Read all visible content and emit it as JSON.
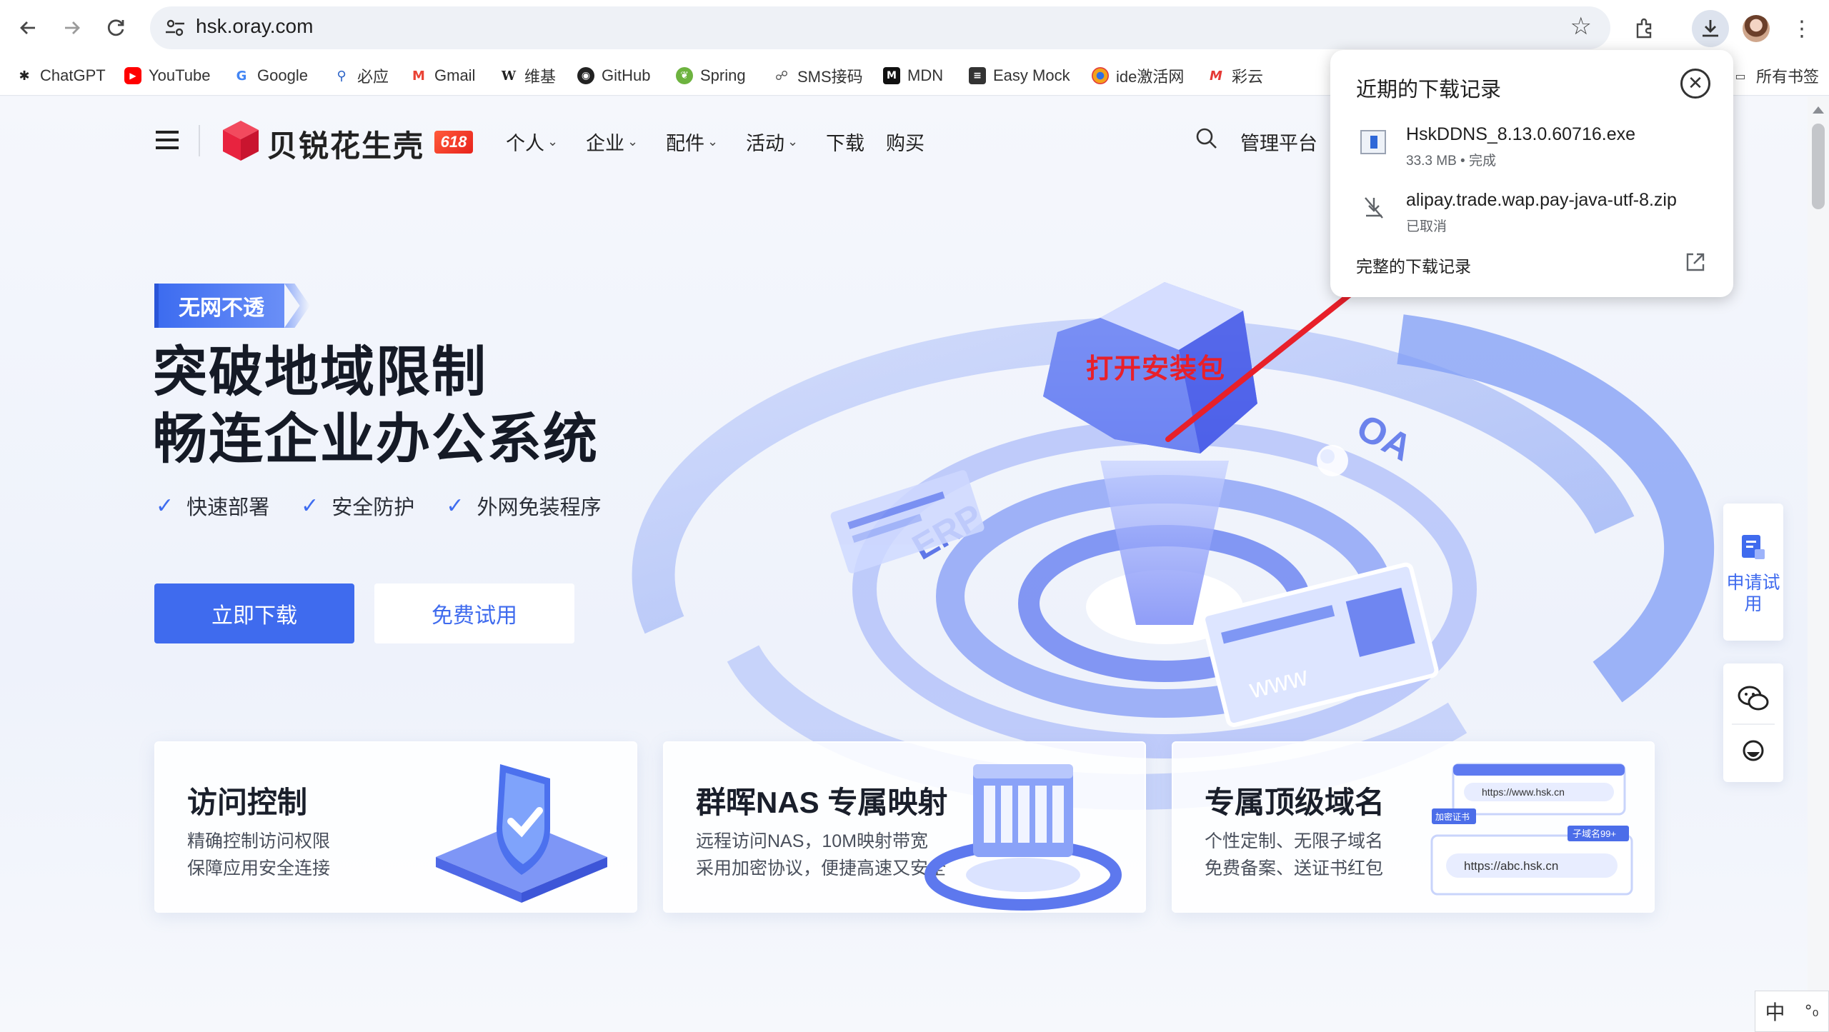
{
  "browser": {
    "url": "hsk.oray.com",
    "bookmarks": [
      {
        "label": "ChatGPT",
        "icon": "chatgpt-icon"
      },
      {
        "label": "YouTube",
        "icon": "youtube-icon"
      },
      {
        "label": "Google",
        "icon": "google-icon"
      },
      {
        "label": "必应",
        "icon": "bing-icon"
      },
      {
        "label": "Gmail",
        "icon": "gmail-icon"
      },
      {
        "label": "维基",
        "icon": "wikipedia-icon"
      },
      {
        "label": "GitHub",
        "icon": "github-icon"
      },
      {
        "label": "Spring",
        "icon": "spring-icon"
      },
      {
        "label": "SMS接码",
        "icon": "sms-icon"
      },
      {
        "label": "MDN",
        "icon": "mdn-icon"
      },
      {
        "label": "Easy Mock",
        "icon": "easy-mock-icon"
      },
      {
        "label": "ide激活网",
        "icon": "ide-icon"
      },
      {
        "label": "彩云",
        "icon": "caiyun-icon"
      }
    ],
    "all_bookmarks": "所有书签"
  },
  "site": {
    "logo_text": "贝锐花生壳",
    "badge": "618",
    "nav": [
      "个人",
      "企业",
      "配件",
      "活动",
      "下载",
      "购买"
    ],
    "console": "管理平台"
  },
  "hero": {
    "tag": "无网不透",
    "title_line1": "突破地域限制",
    "title_line2": "畅连企业办公系统",
    "features": [
      "快速部署",
      "安全防护",
      "外网免装程序"
    ],
    "primary_button": "立即下载",
    "secondary_button": "免费试用",
    "art_labels": {
      "erp": "ERP",
      "oa": "OA",
      "www": "www"
    }
  },
  "annotation": {
    "label": "打开安装包",
    "color": "#e8202a"
  },
  "cards": [
    {
      "title": "访问控制",
      "lines": [
        "精确控制访问权限",
        "保障应用安全连接"
      ]
    },
    {
      "title": "群晖NAS 专属映射",
      "lines": [
        "远程访问NAS，10M映射带宽",
        "采用加密协议，便捷高速又安全"
      ]
    },
    {
      "title": "专属顶级域名",
      "lines": [
        "个性定制、无限子域名",
        "免费备案、送证书红包"
      ],
      "art": {
        "url1": "https://www.hsk.cn",
        "url2": "https://abc.hsk.cn",
        "badge1": "加密证书",
        "badge2": "子域名99+"
      }
    }
  ],
  "side": {
    "apply": "申请试用"
  },
  "ime": {
    "label": "中"
  },
  "downloads": {
    "title": "近期的下载记录",
    "items": [
      {
        "name": "HskDDNS_8.13.0.60716.exe",
        "status": "33.3 MB • 完成"
      },
      {
        "name": "alipay.trade.wap.pay-java-utf-8.zip",
        "status": "已取消"
      }
    ],
    "full_history": "完整的下载记录"
  },
  "colors": {
    "accent": "#3f6bee",
    "brand_red": "#e8233f",
    "annotation": "#e8202a"
  }
}
